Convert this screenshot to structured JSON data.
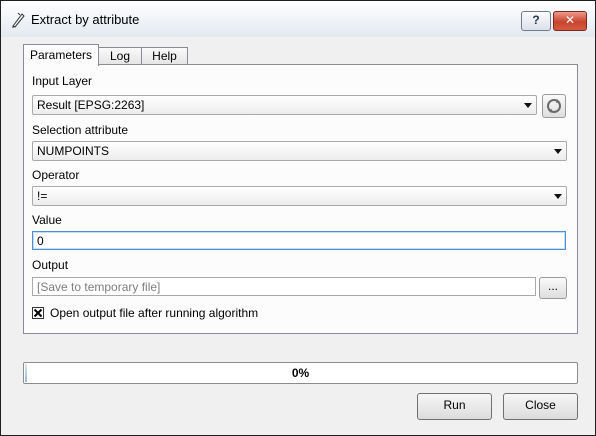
{
  "window": {
    "title": "Extract by attribute",
    "help_label": "?",
    "close_label": "✕"
  },
  "tabs": [
    {
      "label": "Parameters",
      "active": true
    },
    {
      "label": "Log",
      "active": false
    },
    {
      "label": "Help",
      "active": false
    }
  ],
  "form": {
    "input_layer": {
      "label": "Input Layer",
      "value": "Result [EPSG:2263]"
    },
    "selection_attribute": {
      "label": "Selection attribute",
      "value": "NUMPOINTS"
    },
    "operator": {
      "label": "Operator",
      "value": "!="
    },
    "value": {
      "label": "Value",
      "value": "0"
    },
    "output": {
      "label": "Output",
      "placeholder": "[Save to temporary file]",
      "browse_label": "..."
    },
    "open_output": {
      "label": "Open output file after running algorithm",
      "checked": true
    }
  },
  "progress": {
    "text": "0%",
    "value": 0
  },
  "buttons": {
    "run": "Run",
    "close": "Close"
  },
  "icons": {
    "app": "pen-icon",
    "refresh": "refresh-icon",
    "dropdown": "chevron-down-icon",
    "checkbox": "checkbox-checked-icon"
  },
  "colors": {
    "close_button": "#c7452e",
    "focus_border": "#4b8fd6",
    "progress_fill": "#93b6dc"
  }
}
